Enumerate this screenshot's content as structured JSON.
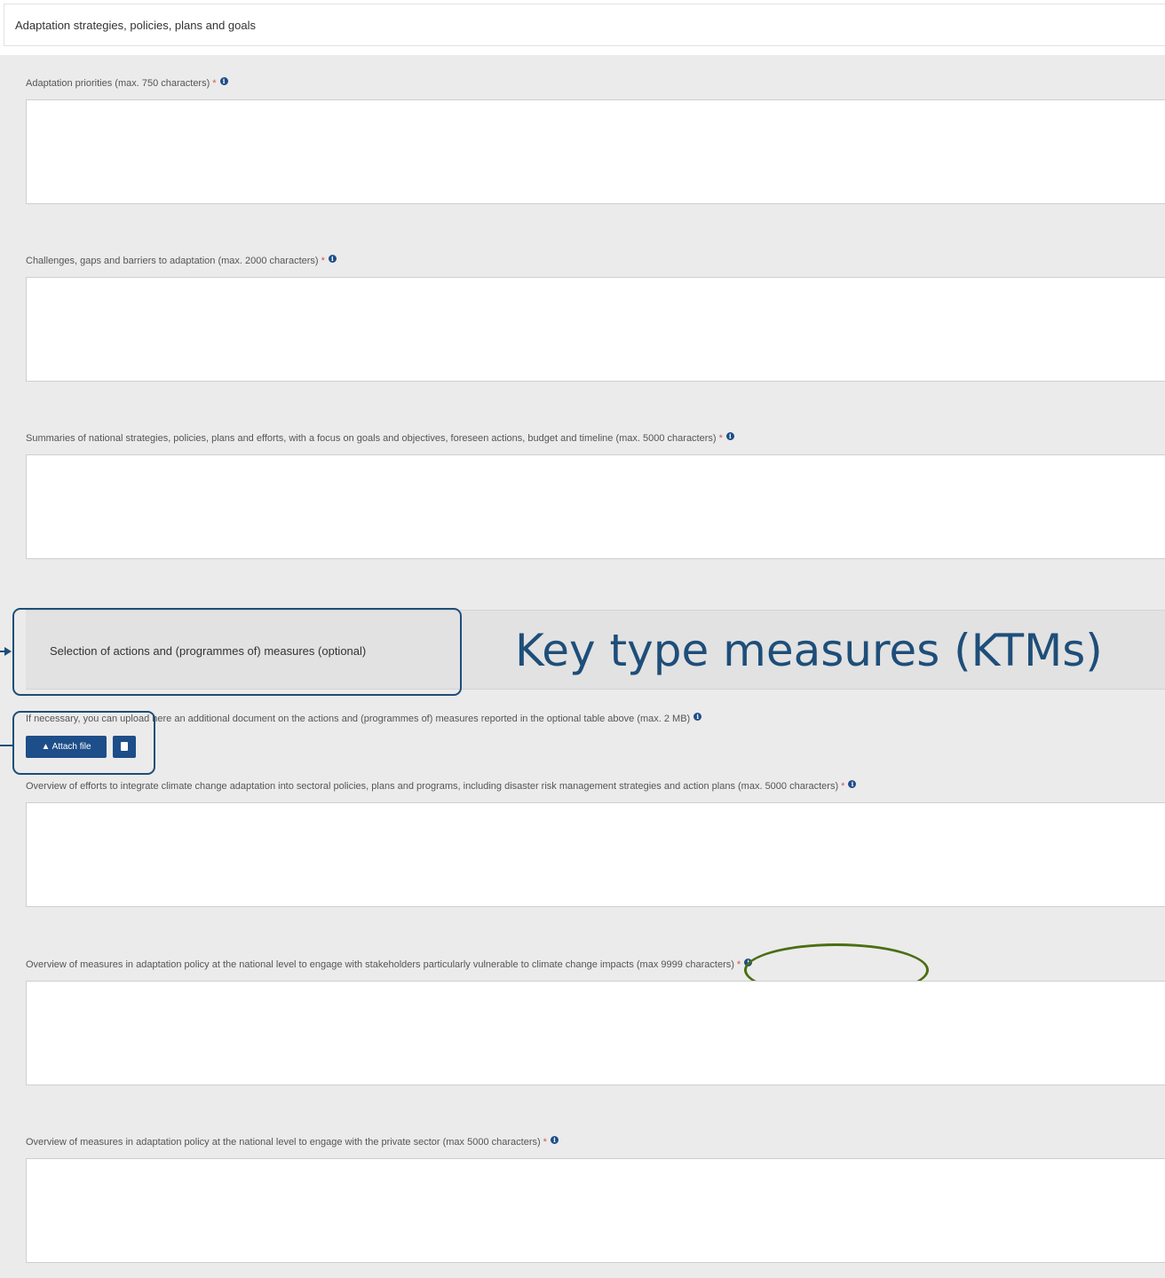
{
  "header": {
    "title": "Adaptation strategies, policies, plans and goals"
  },
  "fields": [
    {
      "label": "Adaptation priorities (max. 750 characters)",
      "required": "*",
      "value": ""
    },
    {
      "label": "Challenges, gaps and barriers to adaptation (max. 2000 characters)",
      "required": "*",
      "value": ""
    },
    {
      "label": "Summaries of national strategies, policies, plans and efforts, with a focus on goals and objectives, foreseen actions, budget and timeline (max. 5000 characters)",
      "required": "*",
      "value": ""
    },
    {
      "label": "Overview of efforts to integrate climate change adaptation into sectoral policies, plans and programs, including disaster risk management strategies and action plans (max. 5000 characters)",
      "required": "*",
      "value": ""
    },
    {
      "label": "Overview of measures in adaptation policy at the national level to engage with stakeholders particularly vulnerable to climate change impacts (max 9999 characters)",
      "required": "*",
      "value": ""
    },
    {
      "label": "Overview of measures in adaptation policy at the national level to engage with the private sector (max 5000 characters)",
      "required": "*",
      "value": ""
    }
  ],
  "measures_section": {
    "label": "Selection of actions and (programmes of) measures (optional)"
  },
  "upload": {
    "label": "If necessary, you can upload here an additional document on the actions and (programmes of) measures reported in the optional table above (max. 2 MB)",
    "attach_label": "Attach file"
  },
  "annotation": {
    "text": "Key type measures (KTMs)"
  },
  "colors": {
    "accent": "#1d4e89",
    "annotation": "#1e4e79",
    "oval": "#4a6e12",
    "required": "#d9534f"
  }
}
